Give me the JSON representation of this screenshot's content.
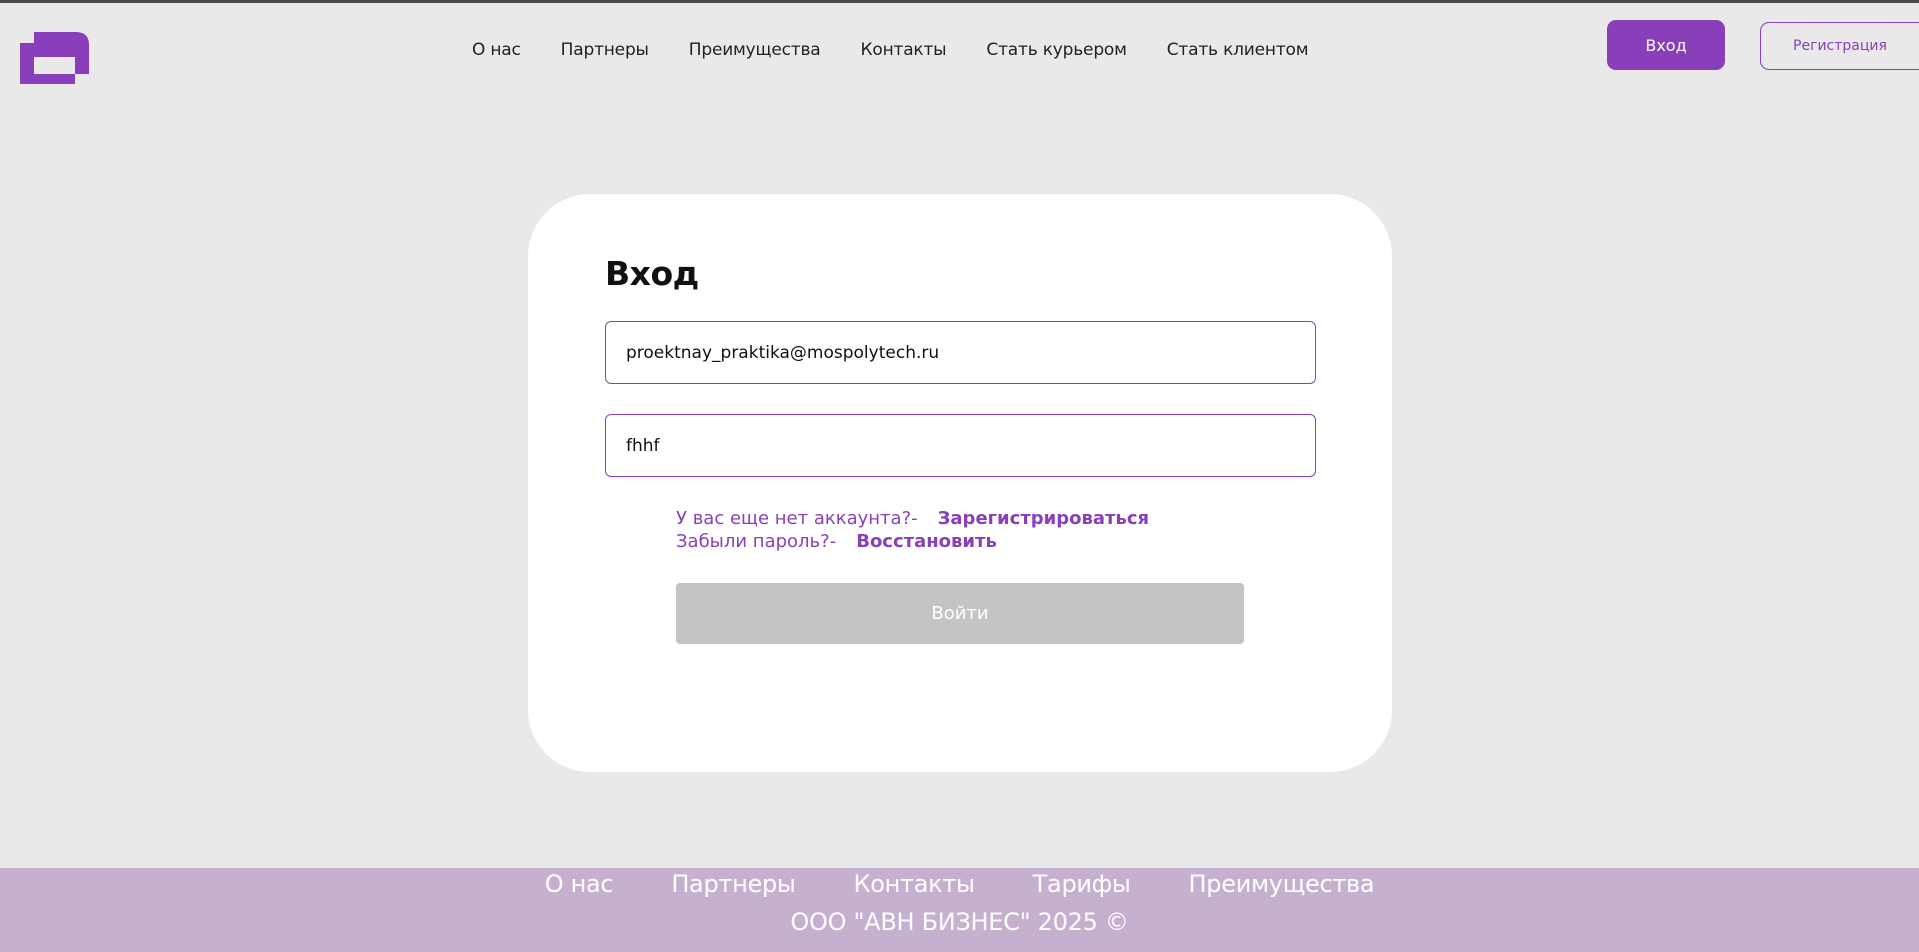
{
  "colors": {
    "accent": "#8a3fba",
    "background": "#e9e9e9",
    "card": "#ffffff",
    "footer": "#c5b1cf",
    "disabled_button": "#c4c4c4"
  },
  "header": {
    "logo_icon": "logo-icon",
    "nav": [
      {
        "label": "О нас"
      },
      {
        "label": "Партнеры"
      },
      {
        "label": "Преимущества"
      },
      {
        "label": "Контакты"
      },
      {
        "label": "Стать курьером"
      },
      {
        "label": "Стать клиентом"
      }
    ],
    "login_label": "Вход",
    "register_label": "Регистрация"
  },
  "form": {
    "title": "Вход",
    "email_value": "proektnay_praktika@mospolytech.ru",
    "password_value": "fhhf",
    "no_account_text": "У вас еще нет аккаунта?-",
    "register_link": "Зарегистрироваться",
    "forgot_text": "Забыли пароль?-",
    "restore_link": "Восстановить",
    "submit_label": "Войти"
  },
  "footer": {
    "nav": [
      {
        "label": "О нас"
      },
      {
        "label": "Партнеры"
      },
      {
        "label": "Контакты"
      },
      {
        "label": "Тарифы"
      },
      {
        "label": "Преимущества"
      }
    ],
    "copyright": "ООО \"АВН БИЗНЕС\" 2025 ©"
  }
}
